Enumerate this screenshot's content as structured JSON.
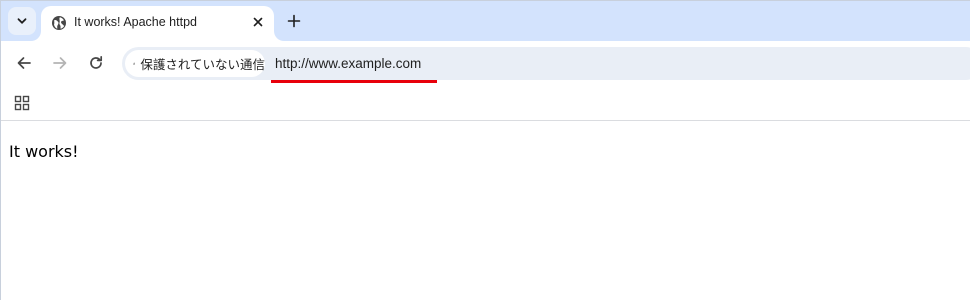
{
  "tabstrip": {
    "tab_search_icon": "chevron-down-icon",
    "active_tab": {
      "title": "It works! Apache httpd",
      "favicon": "globe-icon",
      "close_icon": "close-icon"
    },
    "new_tab_icon": "plus-icon"
  },
  "toolbar": {
    "back_icon": "arrow-left-icon",
    "forward_icon": "arrow-right-icon",
    "reload_icon": "reload-icon",
    "omnibox": {
      "security_icon": "warning-icon",
      "security_label": "保護されていない通信",
      "url": "http://www.example.com"
    },
    "highlight_color": "#e8000b"
  },
  "bookmarks": {
    "apps_icon": "apps-grid-icon"
  },
  "page": {
    "text": "It works!"
  },
  "colors": {
    "tabstrip_bg": "#d3e3fd",
    "omnibox_bg": "#e9eef6",
    "text": "#1f1f1f"
  }
}
